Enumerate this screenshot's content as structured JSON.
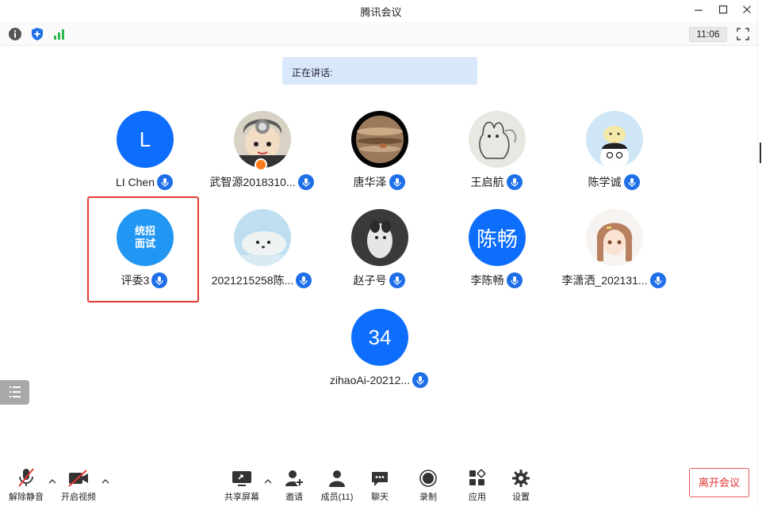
{
  "window": {
    "title": "腾讯会议"
  },
  "statusbar": {
    "time": "11:06"
  },
  "speaking": {
    "label": "正在讲话:"
  },
  "participants": [
    {
      "name": "LI Chen",
      "avatar_text": "L"
    },
    {
      "name": "武智源2018310...",
      "avatar_text": ""
    },
    {
      "name": "唐华泽",
      "avatar_text": ""
    },
    {
      "name": "王启航",
      "avatar_text": ""
    },
    {
      "name": "陈学诚",
      "avatar_text": ""
    },
    {
      "name": "评委3",
      "avatar_line1": "统招",
      "avatar_line2": "面试"
    },
    {
      "name": "2021215258陈...",
      "avatar_text": ""
    },
    {
      "name": "赵子号",
      "avatar_text": ""
    },
    {
      "name": "李陈畅",
      "avatar_text": "陈畅"
    },
    {
      "name": "李潇洒_202131...",
      "avatar_text": ""
    },
    {
      "name": "zihaoAi-20212...",
      "avatar_text": "34"
    }
  ],
  "toolbar": {
    "unmute": "解除静音",
    "start_video": "开启视频",
    "share_screen": "共享屏幕",
    "invite": "邀请",
    "members": "成员(11)",
    "chat": "聊天",
    "record": "录制",
    "apps": "应用",
    "settings": "设置",
    "leave": "离开会议"
  },
  "colors": {
    "accent": "#1e6fe8",
    "leave": "#e0302f",
    "highlight_border": "#e53935"
  },
  "icons": [
    "info-icon",
    "shield-icon",
    "signal-icon",
    "fullscreen-icon",
    "mic-muted-icon",
    "camera-off-icon",
    "share-screen-icon",
    "add-user-icon",
    "members-icon",
    "chat-icon",
    "record-icon",
    "apps-icon",
    "gear-icon"
  ]
}
